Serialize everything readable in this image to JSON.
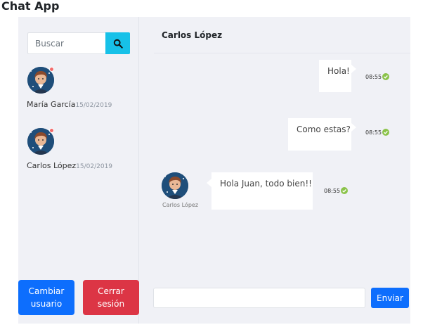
{
  "app": {
    "title": "Chat App"
  },
  "sidebar": {
    "search": {
      "placeholder": "Buscar",
      "value": "",
      "icon": "search-icon"
    },
    "contacts": [
      {
        "name": "María García",
        "date": "15/02/2019",
        "status_color": "#f26a6a"
      },
      {
        "name": "Carlos López",
        "date": "15/02/2019",
        "status_color": "#f26a6a"
      }
    ],
    "buttons": {
      "change_user": "Cambiar usuario",
      "logout": "Cerrar sesión"
    }
  },
  "chat": {
    "contact_name": "Carlos López",
    "messages": [
      {
        "direction": "out",
        "text": "Hola!",
        "time": "08:55"
      },
      {
        "direction": "out",
        "text": "Como estas?",
        "time": "08:55"
      },
      {
        "direction": "in",
        "text": "Hola Juan, todo bien!!",
        "time": "08:55",
        "sender": "Carlos López"
      }
    ],
    "composer": {
      "placeholder": "",
      "value": "",
      "send_label": "Enviar"
    }
  },
  "colors": {
    "primary": "#0d6efd",
    "danger": "#dc3545",
    "search_accent": "#17c1e8",
    "status_dot": "#f26a6a",
    "read_check": "#8bc34a",
    "panel_bg": "#f0f1f6"
  }
}
